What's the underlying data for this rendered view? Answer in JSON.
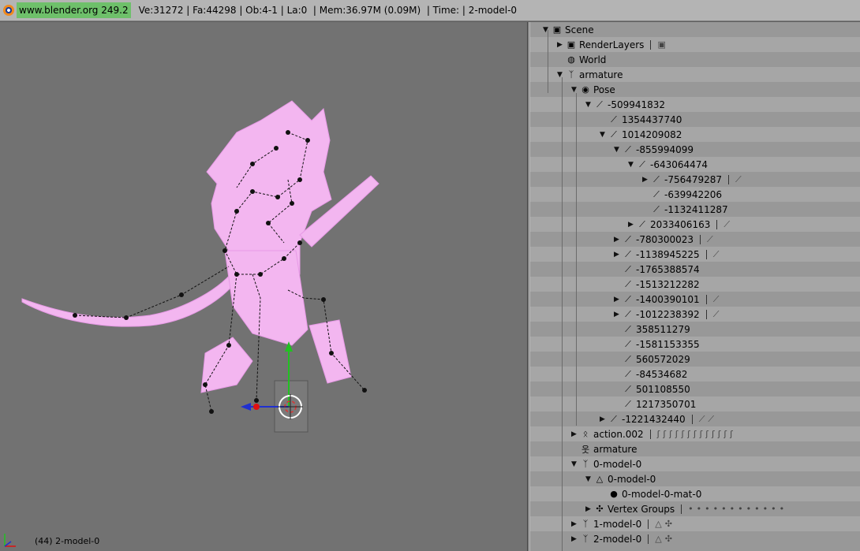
{
  "topbar": {
    "site": "www.blender.org 249.2",
    "stats": "Ve:31272 | Fa:44298 | Ob:4-1 | La:0  | Mem:36.97M (0.09M)  | Time: | 2-model-0"
  },
  "viewport": {
    "status": "(44) 2-model-0"
  },
  "outliner": {
    "rows": [
      {
        "label": "Scene",
        "indent": 0,
        "tri": "▼",
        "icon": "scene-icon",
        "glyph": "▣",
        "extras": []
      },
      {
        "label": "RenderLayers",
        "indent": 1,
        "tri": "▶",
        "icon": "renderlayers-icon",
        "glyph": "▣",
        "extras": [
          "▣"
        ]
      },
      {
        "label": "World",
        "indent": 1,
        "tri": "",
        "icon": "world-icon",
        "glyph": "◍",
        "extras": []
      },
      {
        "label": "armature",
        "indent": 1,
        "tri": "▼",
        "icon": "armature-icon",
        "glyph": "ᛉ",
        "extras": []
      },
      {
        "label": "Pose",
        "indent": 2,
        "tri": "▼",
        "icon": "pose-icon",
        "glyph": "◉",
        "extras": []
      },
      {
        "label": "-509941832",
        "indent": 3,
        "tri": "▼",
        "icon": "bone-icon",
        "glyph": "⟋",
        "extras": []
      },
      {
        "label": "1354437740",
        "indent": 4,
        "tri": "",
        "icon": "bone-icon",
        "glyph": "⟋",
        "extras": []
      },
      {
        "label": "1014209082",
        "indent": 4,
        "tri": "▼",
        "icon": "bone-icon",
        "glyph": "⟋",
        "extras": []
      },
      {
        "label": "-855994099",
        "indent": 5,
        "tri": "▼",
        "icon": "bone-icon",
        "glyph": "⟋",
        "extras": []
      },
      {
        "label": "-643064474",
        "indent": 6,
        "tri": "▼",
        "icon": "bone-icon",
        "glyph": "⟋",
        "extras": []
      },
      {
        "label": "-756479287",
        "indent": 7,
        "tri": "▶",
        "icon": "bone-icon",
        "glyph": "⟋",
        "extras": [
          "⟋"
        ]
      },
      {
        "label": "-639942206",
        "indent": 7,
        "tri": "",
        "icon": "bone-icon",
        "glyph": "⟋",
        "extras": []
      },
      {
        "label": "-1132411287",
        "indent": 7,
        "tri": "",
        "icon": "bone-icon",
        "glyph": "⟋",
        "extras": []
      },
      {
        "label": "2033406163",
        "indent": 6,
        "tri": "▶",
        "icon": "bone-icon",
        "glyph": "⟋",
        "extras": [
          "⟋"
        ]
      },
      {
        "label": "-780300023",
        "indent": 5,
        "tri": "▶",
        "icon": "bone-icon",
        "glyph": "⟋",
        "extras": [
          "⟋"
        ]
      },
      {
        "label": "-1138945225",
        "indent": 5,
        "tri": "▶",
        "icon": "bone-icon",
        "glyph": "⟋",
        "extras": [
          "⟋"
        ]
      },
      {
        "label": "-1765388574",
        "indent": 5,
        "tri": "",
        "icon": "bone-icon",
        "glyph": "⟋",
        "extras": []
      },
      {
        "label": "-1513212282",
        "indent": 5,
        "tri": "",
        "icon": "bone-icon",
        "glyph": "⟋",
        "extras": []
      },
      {
        "label": "-1400390101",
        "indent": 5,
        "tri": "▶",
        "icon": "bone-icon",
        "glyph": "⟋",
        "extras": [
          "⟋"
        ]
      },
      {
        "label": "-1012238392",
        "indent": 5,
        "tri": "▶",
        "icon": "bone-icon",
        "glyph": "⟋",
        "extras": [
          "⟋"
        ]
      },
      {
        "label": "358511279",
        "indent": 5,
        "tri": "",
        "icon": "bone-icon",
        "glyph": "⟋",
        "extras": []
      },
      {
        "label": "-1581153355",
        "indent": 5,
        "tri": "",
        "icon": "bone-icon",
        "glyph": "⟋",
        "extras": []
      },
      {
        "label": "560572029",
        "indent": 5,
        "tri": "",
        "icon": "bone-icon",
        "glyph": "⟋",
        "extras": []
      },
      {
        "label": "-84534682",
        "indent": 5,
        "tri": "",
        "icon": "bone-icon",
        "glyph": "⟋",
        "extras": []
      },
      {
        "label": "501108550",
        "indent": 5,
        "tri": "",
        "icon": "bone-icon",
        "glyph": "⟋",
        "extras": []
      },
      {
        "label": "1217350701",
        "indent": 5,
        "tri": "",
        "icon": "bone-icon",
        "glyph": "⟋",
        "extras": []
      },
      {
        "label": "-1221432440",
        "indent": 4,
        "tri": "▶",
        "icon": "bone-icon",
        "glyph": "⟋",
        "extras": [
          "⟋",
          "⟋"
        ]
      },
      {
        "label": "action.002",
        "indent": 2,
        "tri": "▶",
        "icon": "action-icon",
        "glyph": "ᛟ",
        "extras": [
          "ʃ",
          "ʃ",
          "ʃ",
          "ʃ",
          "ʃ",
          "ʃ",
          "ʃ",
          "ʃ",
          "ʃ",
          "ʃ",
          "ʃ",
          "ʃ",
          "ʃ"
        ]
      },
      {
        "label": "armature",
        "indent": 2,
        "tri": "",
        "icon": "armature-data-icon",
        "glyph": "웃",
        "extras": []
      },
      {
        "label": "0-model-0",
        "indent": 2,
        "tri": "▼",
        "icon": "armature-icon",
        "glyph": "ᛉ",
        "extras": []
      },
      {
        "label": "0-model-0",
        "indent": 3,
        "tri": "▼",
        "icon": "mesh-icon",
        "glyph": "△",
        "extras": []
      },
      {
        "label": "0-model-0-mat-0",
        "indent": 4,
        "tri": "",
        "icon": "material-icon",
        "glyph": "●",
        "extras": []
      },
      {
        "label": "Vertex Groups",
        "indent": 3,
        "tri": "▶",
        "icon": "vertex-groups-icon",
        "glyph": "✣",
        "extras": [
          "•",
          "•",
          "•",
          "•",
          "•",
          "•",
          "•",
          "•",
          "•",
          "•",
          "•",
          "•"
        ]
      },
      {
        "label": "1-model-0",
        "indent": 2,
        "tri": "▶",
        "icon": "armature-icon",
        "glyph": "ᛉ",
        "extras": [
          "△",
          "✣"
        ]
      },
      {
        "label": "2-model-0",
        "indent": 2,
        "tri": "▶",
        "icon": "armature-icon",
        "glyph": "ᛉ",
        "extras": [
          "△",
          "✣"
        ]
      }
    ]
  }
}
